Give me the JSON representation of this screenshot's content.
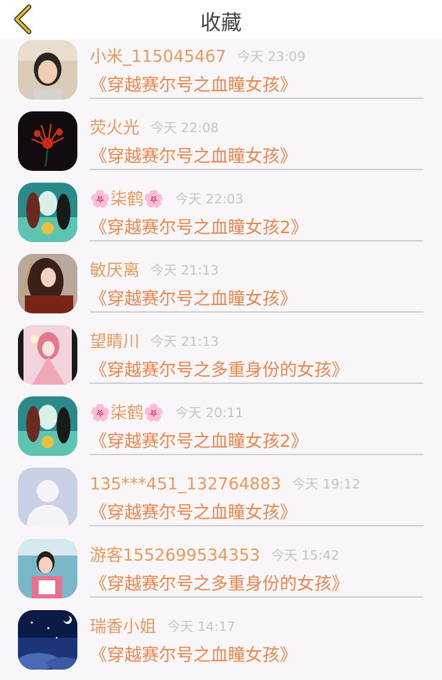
{
  "header": {
    "title": "收藏",
    "back_icon": "chevron-left-icon",
    "accent_color": "#e8c020"
  },
  "favorites": [
    {
      "name": "小米_115045467",
      "time": "今天 23:09",
      "book": "《穿越赛尔号之血瞳女孩》",
      "avatar": "photo-girl-avatar"
    },
    {
      "name": "荧火光",
      "time": "今天 22:08",
      "book": "《穿越赛尔号之血瞳女孩》",
      "avatar": "red-flower-avatar"
    },
    {
      "name": "🌸柒鹤🌸",
      "time": "今天 22:03",
      "book": "《穿越赛尔号之血瞳女孩2》",
      "avatar": "anime-characters-avatar"
    },
    {
      "name": "敏厌离",
      "time": "今天 21:13",
      "book": "《穿越赛尔号之血瞳女孩》",
      "avatar": "anime-warrior-avatar"
    },
    {
      "name": "望睛川",
      "time": "今天 21:13",
      "book": "《穿越赛尔号之多重身份的女孩》",
      "avatar": "anime-pink-girl-avatar"
    },
    {
      "name": "🌸柒鹤🌸",
      "time": "今天 20:11",
      "book": "《穿越赛尔号之血瞳女孩2》",
      "avatar": "anime-characters-avatar"
    },
    {
      "name": "135***451_132764883",
      "time": "今天 19:12",
      "book": "《穿越赛尔号之血瞳女孩》",
      "avatar": "default-user-avatar"
    },
    {
      "name": "游客1552699534353",
      "time": "今天 15:42",
      "book": "《穿越赛尔号之多重身份的女孩》",
      "avatar": "photo-child-avatar"
    },
    {
      "name": "瑞香小姐",
      "time": "今天 14:17",
      "book": "《穿越赛尔号之血瞳女孩》",
      "avatar": "night-sky-avatar"
    }
  ]
}
